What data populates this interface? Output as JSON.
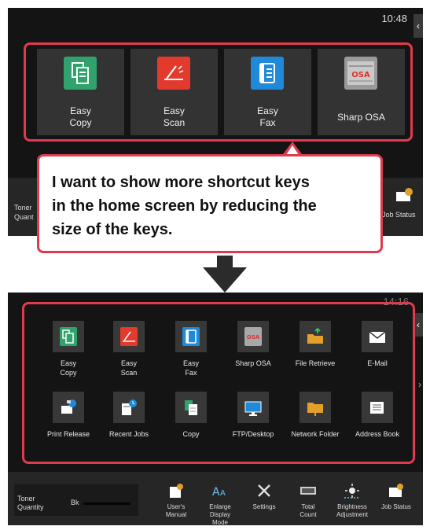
{
  "top_screen": {
    "time": "10:48",
    "tiles": [
      {
        "label_line1": "Easy",
        "label_line2": "Copy",
        "icon": "copy-icon",
        "color": "#2fa36b"
      },
      {
        "label_line1": "Easy",
        "label_line2": "Scan",
        "icon": "scan-icon",
        "color": "#e23b2e"
      },
      {
        "label_line1": "Easy",
        "label_line2": "Fax",
        "icon": "fax-icon",
        "color": "#1f8ad9"
      },
      {
        "label_line1": "Sharp OSA",
        "label_line2": "",
        "icon": "osa-icon",
        "color": "#8a8a8a"
      }
    ],
    "taskbar": {
      "toner_line1": "Toner",
      "toner_line2": "Quant",
      "job_status": "Job Status"
    }
  },
  "callout": {
    "line1": "I want to show more shortcut keys",
    "line2": "in the home screen by reducing the",
    "line3": "size of the keys."
  },
  "bottom_screen": {
    "time": "14:16",
    "tiles": [
      {
        "label_line1": "Easy",
        "label_line2": "Copy",
        "icon": "copy-icon",
        "color": "#2fa36b"
      },
      {
        "label_line1": "Easy",
        "label_line2": "Scan",
        "icon": "scan-icon",
        "color": "#e23b2e"
      },
      {
        "label_line1": "Easy",
        "label_line2": "Fax",
        "icon": "fax-icon",
        "color": "#1f8ad9"
      },
      {
        "label_line1": "Sharp OSA",
        "label_line2": "",
        "icon": "osa-icon",
        "color": "#8a8a8a"
      },
      {
        "label_line1": "File Retrieve",
        "label_line2": "",
        "icon": "folder-arrow-icon",
        "color": "#e2a02b"
      },
      {
        "label_line1": "E-Mail",
        "label_line2": "",
        "icon": "envelope-icon",
        "color": "#ffffff"
      },
      {
        "label_line1": "Print Release",
        "label_line2": "",
        "icon": "print-release-icon",
        "color": "#ffffff"
      },
      {
        "label_line1": "Recent Jobs",
        "label_line2": "",
        "icon": "recent-jobs-icon",
        "color": "#ffffff"
      },
      {
        "label_line1": "Copy",
        "label_line2": "",
        "icon": "copy-icon",
        "color": "#ffffff"
      },
      {
        "label_line1": "FTP/Desktop",
        "label_line2": "",
        "icon": "monitor-icon",
        "color": "#1f8ad9"
      },
      {
        "label_line1": "Network Folder",
        "label_line2": "",
        "icon": "folder-icon",
        "color": "#e2a02b"
      },
      {
        "label_line1": "Address Book",
        "label_line2": "",
        "icon": "address-book-icon",
        "color": "#ffffff"
      }
    ],
    "taskbar": {
      "toner_line1": "Toner",
      "toner_line2": "Quantity",
      "bk": "Bk",
      "buttons": [
        {
          "line1": "User's",
          "line2": "Manual",
          "line3": "",
          "icon": "manual-icon"
        },
        {
          "line1": "Enlarge",
          "line2": "Display",
          "line3": "Mode",
          "icon": "enlarge-text-icon"
        },
        {
          "line1": "Settings",
          "line2": "",
          "line3": "",
          "icon": "settings-icon"
        },
        {
          "line1": "Total",
          "line2": "Count",
          "line3": "",
          "icon": "counter-icon"
        },
        {
          "line1": "Brightness",
          "line2": "Adjustment",
          "line3": "",
          "icon": "brightness-icon"
        },
        {
          "line1": "Job Status",
          "line2": "",
          "line3": "",
          "icon": "job-status-icon"
        }
      ]
    }
  },
  "colors": {
    "highlight": "#e03a4e",
    "panel_bg": "#141414",
    "tile_bg": "#333333"
  }
}
